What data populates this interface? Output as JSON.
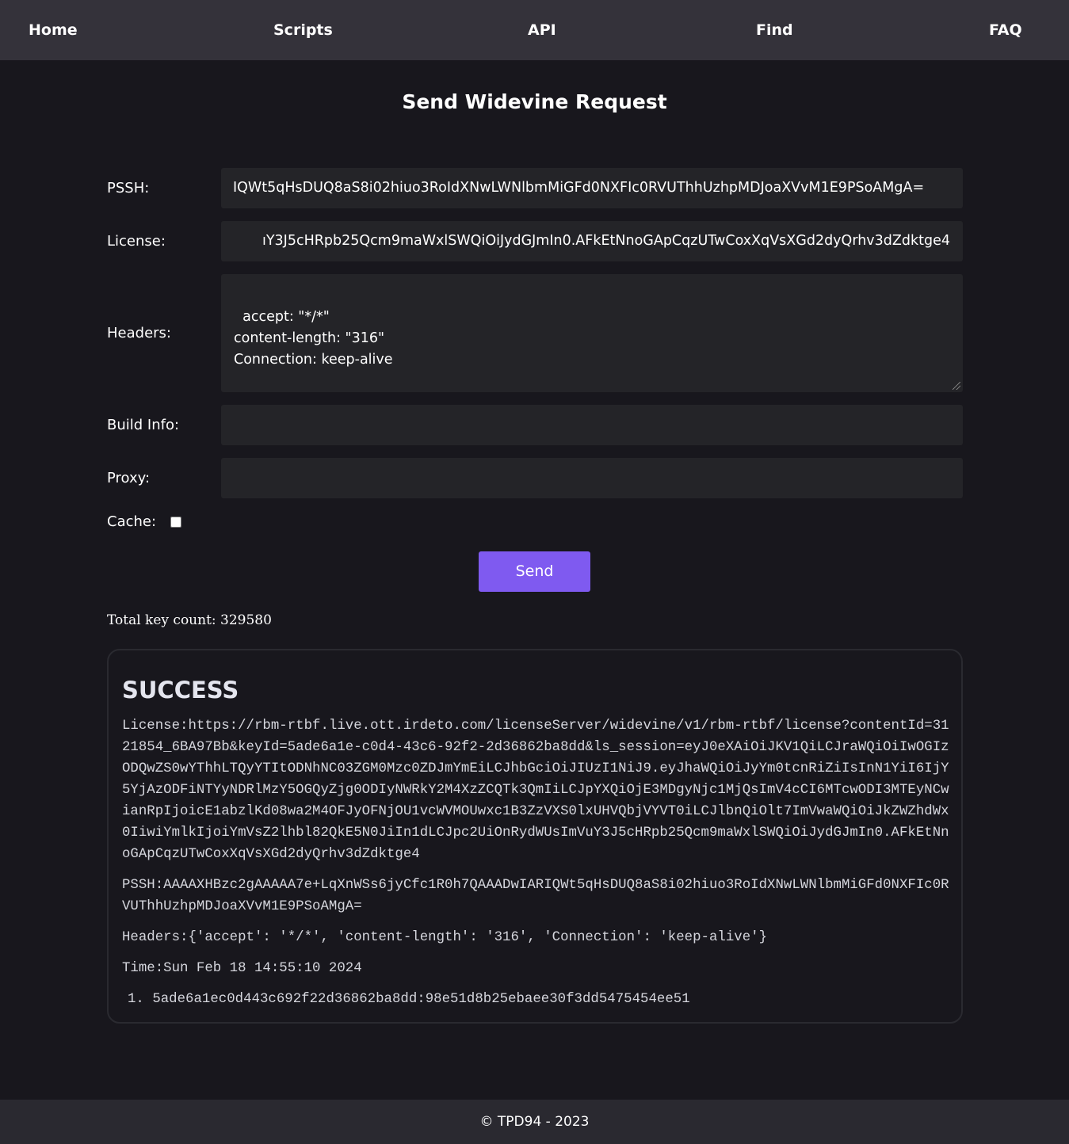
{
  "nav": {
    "home": "Home",
    "scripts": "Scripts",
    "api": "API",
    "find": "Find",
    "faq": "FAQ"
  },
  "page_title": "Send Widevine Request",
  "form": {
    "pssh_label": "PSSH:",
    "pssh_value": "IQWt5qHsDUQ8aS8i02hiuo3RoIdXNwLWNlbmMiGFd0NXFIc0RVUThhUzhpMDJoaXVvM1E9PSoAMgA=",
    "license_label": "License:",
    "license_value": "ıY3J5cHRpb25Qcm9maWxlSWQiOiJydGJmIn0.AFkEtNnoGApCqzUTwCoxXqVsXGd2dyQrhv3dZdktge4",
    "headers_label": "Headers:",
    "headers_value": "accept: \"*/*\"\ncontent-length: \"316\"\nConnection: keep-alive",
    "build_info_label": "Build Info:",
    "build_info_value": "",
    "proxy_label": "Proxy:",
    "proxy_value": "",
    "cache_label": "Cache:",
    "cache_checked": false,
    "send_label": "Send"
  },
  "total_key_count": "Total key count: 329580",
  "result": {
    "status": "SUCCESS",
    "license": "License:https://rbm-rtbf.live.ott.irdeto.com/licenseServer/widevine/v1/rbm-rtbf/license?contentId=3121854_6BA97Bb&keyId=5ade6a1e-c0d4-43c6-92f2-2d36862ba8dd&ls_session=eyJ0eXAiOiJKV1QiLCJraWQiOiIwOGIzODQwZS0wYThhLTQyYTItODNhNC03ZGM0Mzc0ZDJmYmEiLCJhbGciOiJIUzI1NiJ9.eyJhaWQiOiJyYm0tcnRiZiIsInN1YiI6IjY5YjAzODFiNTYyNDRlMzY5OGQyZjg0ODIyNWRkY2M4XzZCQTk3QmIiLCJpYXQiOjE3MDgyNjc1MjQsImV4cCI6MTcwODI3MTEyNCwianRpIjoicE1abzlKd08wa2M4OFJyOFNjOU1vcWVMOUwxc1B3ZzVXS0lxUHVQbjVYVT0iLCJlbnQiOlt7ImVwaWQiOiJkZWZhdWx0IiwiYmlkIjoiYmVsZ2lhbl82QkE5N0JiIn1dLCJpc2UiOnRydWUsImVuY3J5cHRpb25Qcm9maWxlSWQiOiJydGJmIn0.AFkEtNnoGApCqzUTwCoxXqVsXGd2dyQrhv3dZdktge4",
    "pssh": "PSSH:AAAAXHBzc2gAAAAA7e+LqXnWSs6jyCfc1R0h7QAAADwIARIQWt5qHsDUQ8aS8i02hiuo3RoIdXNwLWNlbmMiGFd0NXFIc0RVUThhUzhpMDJoaXVvM1E9PSoAMgA=",
    "headers": "Headers:{'accept': '*/*', 'content-length': '316', 'Connection': 'keep-alive'}",
    "time": "Time:Sun Feb 18 14:55:10 2024",
    "keys": [
      {
        "index": "1.",
        "value": "5ade6a1ec0d443c692f22d36862ba8dd:98e51d8b25ebaee30f3dd5475454ee51"
      }
    ]
  },
  "footer": "© TPD94 - 2023",
  "colors": {
    "background": "#18171d",
    "nav": "#34323a",
    "field": "#242428",
    "accent": "#7f5af0",
    "footer": "#2a2930"
  }
}
